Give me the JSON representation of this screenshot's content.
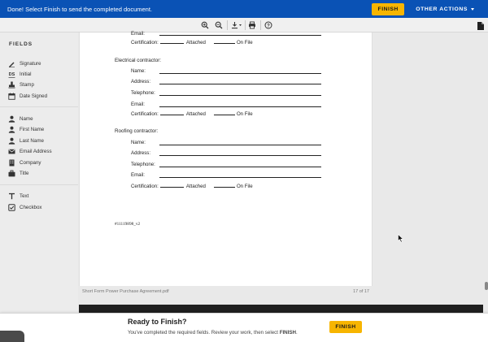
{
  "topbar": {
    "message": "Done! Select Finish to send the completed document.",
    "finish_label": "FINISH",
    "other_actions_label": "OTHER ACTIONS",
    "bg_color": "#0a52b5",
    "accent_color": "#f7b500"
  },
  "toolbar": {
    "icons": [
      "zoom-in-icon",
      "zoom-out-icon",
      "download-icon",
      "print-icon",
      "help-icon"
    ]
  },
  "sidebar": {
    "title": "FIELDS",
    "groups": [
      {
        "items": [
          {
            "label": "Signature",
            "icon": "pen-icon"
          },
          {
            "label": "Initial",
            "icon": "initials-icon"
          },
          {
            "label": "Stamp",
            "icon": "stamp-icon"
          },
          {
            "label": "Date Signed",
            "icon": "calendar-icon"
          }
        ]
      },
      {
        "items": [
          {
            "label": "Name",
            "icon": "person-icon"
          },
          {
            "label": "First Name",
            "icon": "person-icon"
          },
          {
            "label": "Last Name",
            "icon": "person-icon"
          },
          {
            "label": "Email Address",
            "icon": "envelope-icon"
          },
          {
            "label": "Company",
            "icon": "building-icon"
          },
          {
            "label": "Title",
            "icon": "briefcase-icon"
          }
        ]
      },
      {
        "items": [
          {
            "label": "Text",
            "icon": "text-icon"
          },
          {
            "label": "Checkbox",
            "icon": "checkbox-icon"
          }
        ]
      }
    ]
  },
  "document": {
    "top_partial": {
      "email_label": "Email:",
      "cert_label": "Certification:",
      "attached": "Attached",
      "on_file": "On File"
    },
    "sections": [
      {
        "heading": "Electrical contractor:",
        "rows": [
          "Name:",
          "Address:",
          "Telephone:",
          "Email:"
        ],
        "cert_label": "Certification:",
        "attached": "Attached",
        "on_file": "On File"
      },
      {
        "heading": "Roofing contractor:",
        "rows": [
          "Name:",
          "Address:",
          "Telephone:",
          "Email:"
        ],
        "cert_label": "Certification:",
        "attached": "Attached",
        "on_file": "On File"
      }
    ],
    "doc_id": "#11119898_v2"
  },
  "footer": {
    "filename": "Short Form Power Purchase Agreement.pdf",
    "page_indicator": "17 of 17"
  },
  "bottom_bar": {
    "title": "Ready to Finish?",
    "desc_prefix": "You've completed the required fields. Review your work, then select ",
    "desc_bold": "FINISH",
    "desc_suffix": ".",
    "finish_label": "FINISH"
  }
}
